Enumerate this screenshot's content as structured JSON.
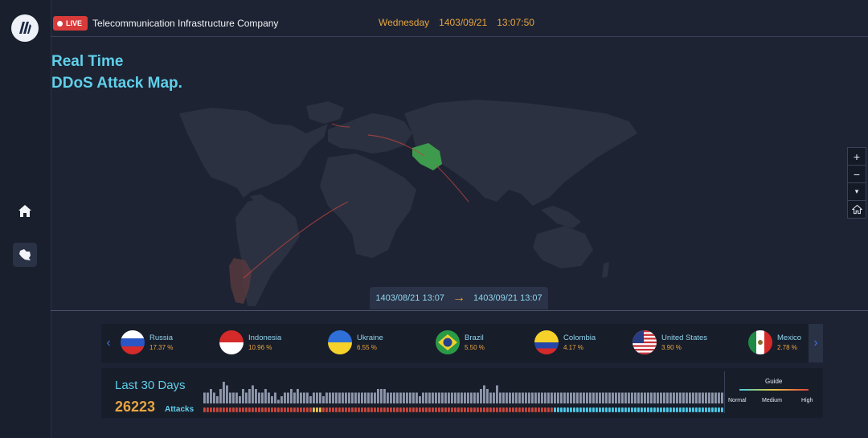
{
  "header": {
    "live_label": "LIVE",
    "company": "Telecommunication Infrastructure Company",
    "day": "Wednesday",
    "date": "1403/09/21",
    "time": "13:07:50"
  },
  "title": {
    "line1": "Real Time",
    "line2": "DDoS Attack Map."
  },
  "sidebar": {
    "items": [
      {
        "icon": "home-icon"
      },
      {
        "icon": "iran-map-icon"
      }
    ]
  },
  "zoom_controls": {
    "zoom_in": "+",
    "zoom_out": "−",
    "expand": "▾"
  },
  "range": {
    "from": "1403/08/21 13:07",
    "to": "1403/09/21 13:07"
  },
  "countries": [
    {
      "name": "Russia",
      "pct": "17.37 %"
    },
    {
      "name": "Indonesia",
      "pct": "10.96 %"
    },
    {
      "name": "Ukraine",
      "pct": "6.55 %"
    },
    {
      "name": "Brazil",
      "pct": "5.50 %"
    },
    {
      "name": "Colombia",
      "pct": "4.17 %"
    },
    {
      "name": "United States",
      "pct": "3.90 %"
    },
    {
      "name": "Mexico",
      "pct": "2.78 %"
    }
  ],
  "stats": {
    "label": "Last 30 Days",
    "count": "26223",
    "unit": "Attacks"
  },
  "guide": {
    "title": "Guide",
    "low": "Normal",
    "mid": "Medium",
    "high": "High"
  },
  "colors": {
    "accent": "#5fd0ea",
    "orange": "#e7a540",
    "live": "#d93b3b",
    "bar": "#8e97ab",
    "iran": "#3e9a4c"
  },
  "timeline": {
    "bars": [
      3,
      3,
      4,
      3,
      2,
      4,
      6,
      5,
      3,
      3,
      3,
      2,
      4,
      3,
      4,
      5,
      4,
      3,
      3,
      4,
      3,
      2,
      3,
      1,
      2,
      3,
      3,
      4,
      3,
      4,
      3,
      3,
      3,
      2,
      3,
      3,
      3,
      2,
      3,
      3,
      3,
      3,
      3,
      3,
      3,
      3,
      3,
      3,
      3,
      3,
      3,
      3,
      3,
      3,
      4,
      4,
      4,
      3,
      3,
      3,
      3,
      3,
      3,
      3,
      3,
      3,
      3,
      2,
      3,
      3,
      3,
      3,
      3,
      3,
      3,
      3,
      3,
      3,
      3,
      3,
      3,
      3,
      3,
      3,
      3,
      3,
      4,
      5,
      4,
      3,
      3,
      5,
      3,
      3,
      3,
      3,
      3,
      3,
      3,
      3,
      3,
      3,
      3,
      3,
      3,
      3,
      3,
      3,
      3,
      3,
      3,
      3,
      3,
      3,
      3,
      3,
      3,
      3,
      3,
      3,
      3,
      3,
      3,
      3,
      3,
      3,
      3,
      3,
      3,
      3,
      3,
      3,
      3,
      3,
      3,
      3,
      3,
      3,
      3,
      3,
      3,
      3,
      3,
      3,
      3,
      3,
      3,
      3,
      3,
      3,
      3,
      3,
      3,
      3,
      3,
      3,
      3,
      3,
      3,
      3,
      3,
      3
    ],
    "levels": "rrrrrrrrrrrrrrrrrrrrrrrrrrrrrrrrrryyyrrrrrrrrrrrrrrrrrrrrrrrrrrrrrrrrrrrrrrrrrrrrrrrrrrrrrrrrrrrrrrrrrrrrrrrrbbbbbbbbbbbbbbbbbbbbbbbbbbbbbbbbbbbbbbbbbbbbbbbbbbbbbbbbbbbbbbbb"
  }
}
